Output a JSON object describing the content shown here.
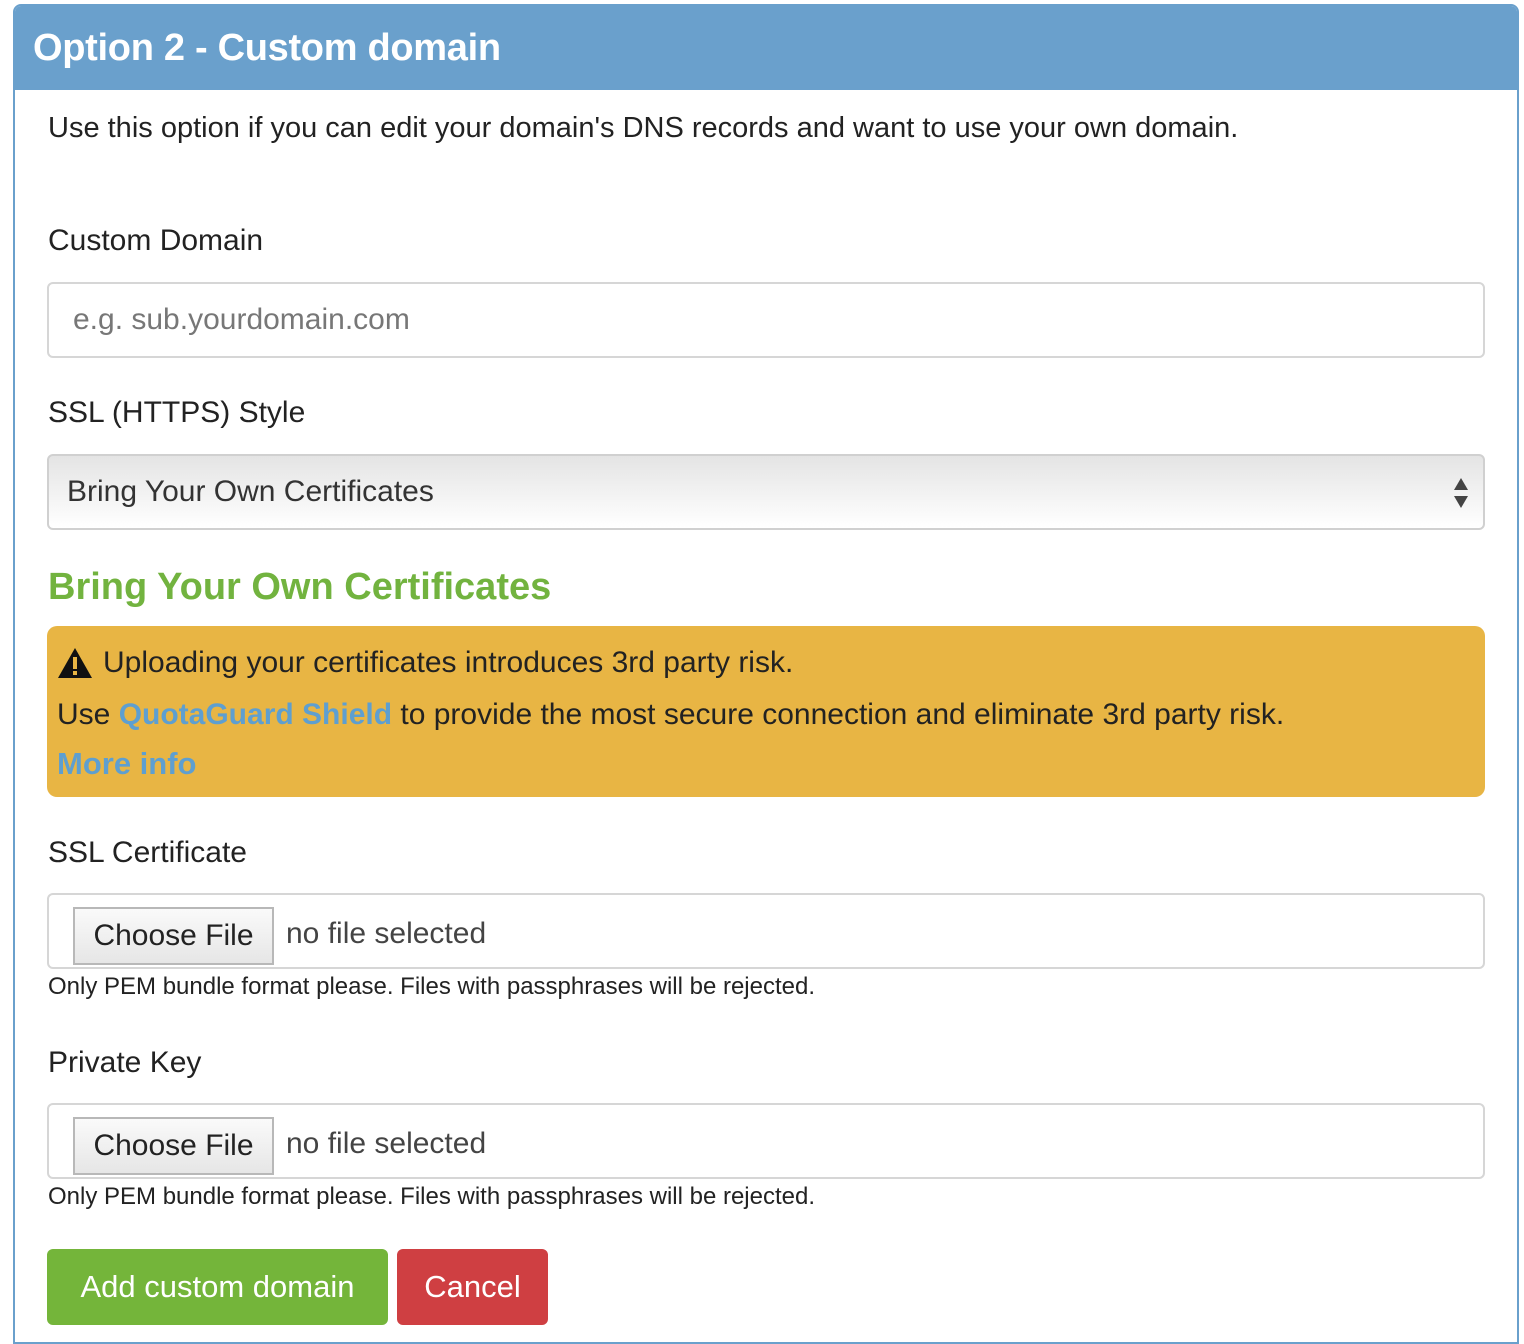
{
  "panel": {
    "title": "Option 2 - Custom domain",
    "intro": "Use this option if you can edit your domain's DNS records and want to use your own domain."
  },
  "custom_domain": {
    "label": "Custom Domain",
    "placeholder": "e.g. sub.yourdomain.com",
    "value": ""
  },
  "ssl_style": {
    "label": "SSL (HTTPS) Style",
    "selected": "Bring Your Own Certificates"
  },
  "byoc": {
    "title": "Bring Your Own Certificates",
    "warning": {
      "line1": "Uploading your certificates introduces 3rd party risk.",
      "line2_prefix": "Use ",
      "line2_link": "QuotaGuard Shield",
      "line2_suffix": " to provide the most secure connection and eliminate 3rd party risk.",
      "more_info": "More info"
    }
  },
  "ssl_certificate": {
    "label": "SSL Certificate",
    "button": "Choose File",
    "status": "no file selected",
    "help": "Only PEM bundle format please. Files with passphrases will be rejected."
  },
  "private_key": {
    "label": "Private Key",
    "button": "Choose File",
    "status": "no file selected",
    "help": "Only PEM bundle format please. Files with passphrases will be rejected."
  },
  "actions": {
    "add_label": "Add custom domain",
    "cancel_label": "Cancel"
  },
  "colors": {
    "header": "#6aa0cc",
    "section_title": "#72b33f",
    "warning_bg": "#e8b544",
    "link": "#5e9fd0",
    "add_button": "#74b53a",
    "cancel_button": "#cf3f42"
  },
  "icons": {
    "warning": "warning-triangle-icon",
    "select": "select-arrows-icon"
  }
}
